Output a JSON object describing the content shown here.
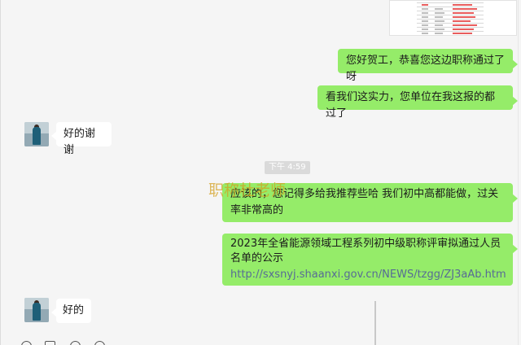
{
  "messages": [
    {
      "side": "out",
      "text": "您好贺工，恭喜您这边职称通过了呀"
    },
    {
      "side": "out",
      "text": "看我们这实力，您单位在我这报的都过了"
    },
    {
      "side": "in",
      "text": "好的谢谢"
    },
    {
      "side": "out",
      "text": "应该的，您记得多给我推荐些哈 我们初中高都能做，过关率非常高的"
    },
    {
      "side": "out",
      "text": "2023年全省能源领域工程系列初中级职称评审拟通过人员名单的公示",
      "link": "http://sxsnyj.shaanxi.gov.cn/NEWS/tzgg/ZJ3aAb.htm"
    },
    {
      "side": "in",
      "text": "好的"
    }
  ],
  "timestamp": "下午 4:59",
  "watermark": "职称杜老师",
  "colors": {
    "outgoing_bubble": "#95ec69",
    "incoming_bubble": "#ffffff",
    "background": "#f5f5f5",
    "link": "#576b95"
  },
  "icons": [
    "emoji-icon",
    "folder-icon",
    "scissors-icon",
    "chat-history-icon"
  ]
}
